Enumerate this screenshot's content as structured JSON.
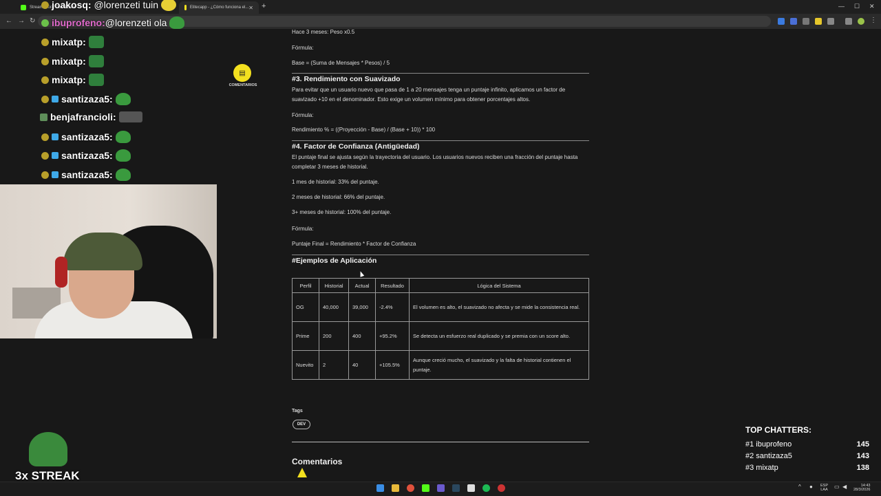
{
  "browser": {
    "tabs": [
      {
        "title": "Stream - Kick Dashboard"
      },
      {
        "title": "Elitecapp - ¿Cómo funciona el..."
      }
    ],
    "new_tab": "+",
    "close": "✕",
    "window_controls": [
      "—",
      "☐",
      "✕"
    ]
  },
  "article": {
    "line_top": "Hace 3 meses: Peso x0.5",
    "formula_label_1": "Fórmula:",
    "formula_1": "Base = (Suma de Mensajes * Pesos) / 5",
    "section3_title": "#3. Rendimiento con Suavizado",
    "section3_text": "Para evitar que un usuario nuevo que pasa de 1 a 20 mensajes tenga un puntaje infinito, aplicamos un factor de suavizado +10 en el denominador. Esto exige un volumen mínimo para obtener porcentajes altos.",
    "formula_label_2": "Fórmula:",
    "formula_2": "Rendimiento % = ((Proyección - Base) / (Base + 10)) * 100",
    "section4_title": "#4. Factor de Confianza (Antigüedad)",
    "section4_text": "El puntaje final se ajusta según la trayectoria del usuario. Los usuarios nuevos reciben una fracción del puntaje hasta completar 3 meses de historial.",
    "hist_1": "1 mes de historial: 33% del puntaje.",
    "hist_2": "2 meses de historial: 66% del puntaje.",
    "hist_3": "3+ meses de historial: 100% del puntaje.",
    "formula_label_3": "Fórmula:",
    "formula_3": "Puntaje Final = Rendimiento * Factor de Confianza",
    "examples_title": "#Ejemplos de Aplicación",
    "table": {
      "headers": [
        "Perfil",
        "Historial",
        "Actual",
        "Resultado",
        "Lógica del Sistema"
      ],
      "rows": [
        [
          "OG",
          "40,000",
          "39,000",
          "-2.4%",
          "El volumen es alto, el suavizado no afecta y se mide la consistencia real."
        ],
        [
          "Prime",
          "200",
          "400",
          "+95.2%",
          "Se detecta un esfuerzo real duplicado y se premia con un score alto."
        ],
        [
          "Nuevito",
          "2",
          "40",
          "+105.5%",
          "Aunque creció mucho, el suavizado y la falta de historial contienen el puntaje."
        ]
      ]
    },
    "tags_title": "Tags",
    "tag": "DEV",
    "comments_title": "Comentarios"
  },
  "floating": {
    "comments_label": "COMENTARIOS",
    "comments_icon": "comment-icon"
  },
  "chat": [
    {
      "nick": "joakosq:",
      "text": "@lorenzeti tuin",
      "color": "#ffffff"
    },
    {
      "nick": "ibuprofeno:",
      "text": "@lorenzeti ola",
      "color": "#e06acb"
    },
    {
      "nick": "mixatp:",
      "text": "",
      "color": "#ffffff"
    },
    {
      "nick": "mixatp:",
      "text": "",
      "color": "#ffffff"
    },
    {
      "nick": "mixatp:",
      "text": "",
      "color": "#ffffff"
    },
    {
      "nick": "santizaza5:",
      "text": "",
      "color": "#ffffff"
    },
    {
      "nick": "benjafrancioli:",
      "text": "",
      "color": "#ffffff"
    },
    {
      "nick": "santizaza5:",
      "text": "",
      "color": "#ffffff"
    },
    {
      "nick": "santizaza5:",
      "text": "",
      "color": "#ffffff"
    },
    {
      "nick": "santizaza5:",
      "text": "",
      "color": "#ffffff"
    }
  ],
  "streak": "3x STREAK",
  "top_chatters": {
    "title": "TOP CHATTERS:",
    "rows": [
      {
        "name": "#1 ibuprofeno",
        "count": "145"
      },
      {
        "name": "#2 santizaza5",
        "count": "143"
      },
      {
        "name": "#3 mixatp",
        "count": "138"
      }
    ]
  },
  "taskbar": {
    "lang": "ESP",
    "lang2": "LAA",
    "time": "14:43",
    "date": "28/3/2026"
  },
  "colors": {
    "accent_yellow": "#f3e01f",
    "kick_green": "#53fc18"
  }
}
